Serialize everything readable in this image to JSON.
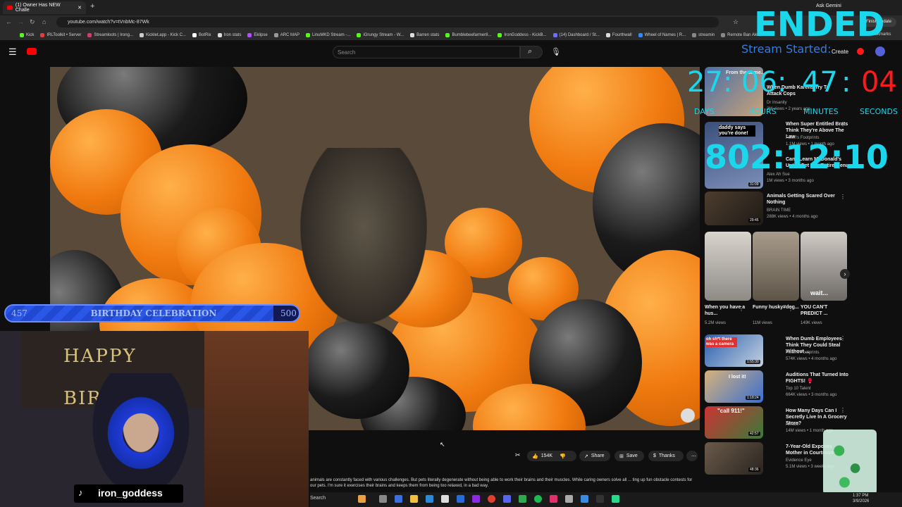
{
  "browser": {
    "tabs": [
      {
        "title": "(1) Owner Has NEW Challe"
      }
    ],
    "url": "youtube.com/watch?v=tVnbMc-87Wk",
    "ask_label": "Ask Gemini",
    "update_label": "Finish update",
    "all_bookmarks": "All Bookmarks",
    "bookmarks": [
      {
        "label": "Kick",
        "color": "#53fc18"
      },
      {
        "label": "IRLToolkit • Server",
        "color": "#e23c3c"
      },
      {
        "label": "Streamloots | Irong...",
        "color": "#d23b6f"
      },
      {
        "label": "Kicklet.app - Kick C...",
        "color": "#cccccc"
      },
      {
        "label": "BotRix",
        "color": "#ffffff"
      },
      {
        "label": "Iron stats",
        "color": "#dddddd"
      },
      {
        "label": "Eklipse",
        "color": "#b44dff"
      },
      {
        "label": "ARC MAP",
        "color": "#999999"
      },
      {
        "label": "LinuMKD Stream -...",
        "color": "#53fc18"
      },
      {
        "label": "iGrungy Stream - W...",
        "color": "#53fc18"
      },
      {
        "label": "Barren stats",
        "color": "#dddddd"
      },
      {
        "label": "Bumblebeefarmer8...",
        "color": "#53fc18"
      },
      {
        "label": "IronGoddess - KickB...",
        "color": "#53fc18"
      },
      {
        "label": "(14) Dashboard / St...",
        "color": "#6f6fff"
      },
      {
        "label": "Fourthwall",
        "color": "#dddddd"
      },
      {
        "label": "Wheel of Names | R...",
        "color": "#2d8cff"
      },
      {
        "label": "streamin",
        "color": "#888888"
      },
      {
        "label": "Remote Ban Alerts",
        "color": "#888888"
      }
    ]
  },
  "youtube": {
    "search_placeholder": "Search",
    "create_label": "Create",
    "description": "animals are constantly faced with various challenges. But pets literally degenerate without being able to work their brains and their muscles. While caring owners solve all ... ting up fun obstacle contests for our pets. I'm sure it exercises their brains and keeps them from being too relaxed, in a bad way.",
    "likes": "154K",
    "share_label": "Share",
    "save_label": "Save",
    "thanks_label": "Thanks"
  },
  "recommendations": [
    {
      "title": "From the same...",
      "channel": "",
      "meta": "",
      "duration": ""
    },
    {
      "title": "When Dumb Karens Try To Attack Cops",
      "channel": "Dr Insanity",
      "meta": "2M views • 2 years ago",
      "duration": ""
    },
    {
      "title": "When Super Entitled Brats Think They're Above The Law",
      "channel": "Felon's Footprints",
      "meta": "1.1M views • 1 month ago",
      "duration": ""
    },
    {
      "title": "Can I Learn McDonald's Until I Get The Entire Menu",
      "channel": "Alex Ah Sue",
      "meta": "1M views • 3 months ago",
      "duration": "31:09"
    },
    {
      "title": "Animals Getting Scared Over Nothing",
      "channel": "BRAIN TIME",
      "meta": "288K views • 4 months ago",
      "duration": "29:45"
    },
    {
      "title": "When Dumb Employees Think They Could Steal Without ...",
      "channel": "Felon's Footprints",
      "meta": "574K views • 4 months ago",
      "duration": "1:55:30"
    },
    {
      "title": "Auditions That Turned Into FIGHTS! 🥊",
      "channel": "Top 10 Talent",
      "meta": "664K views • 3 months ago",
      "duration": "1:18:24"
    },
    {
      "title": "How Many Days Can I Secretly Live In A Grocery Store?",
      "channel": "Airrack",
      "meta": "14M views • 1 month ago",
      "duration": "42:57"
    },
    {
      "title": "7-Year-Old Exposes Mother in Courtroom",
      "channel": "Evidence Eye",
      "meta": "5.1M views • 3 weeks ago",
      "duration": "48:36"
    }
  ],
  "shorts": [
    {
      "title": "When you have a hus...",
      "views": "5.2M views"
    },
    {
      "title": "Funny husky#dog...",
      "views": "11M views"
    },
    {
      "title": "YOU CAN'T PREDICT ...",
      "views": "149K views"
    }
  ],
  "thumb_texts": {
    "daddy": "daddy says you're done!",
    "ohsht": "oh sh*t there was a camera",
    "lost": "I lost it!",
    "call": "\"call 911!\"",
    "wait": "wait..."
  },
  "overlay": {
    "ended": "ENDED",
    "stream_started": "Stream Started:",
    "countdown": {
      "days": "27",
      "hours": "06",
      "minutes": "47",
      "seconds": "04",
      "sep": ":"
    },
    "countdown_labels": {
      "days": "DAYS",
      "hours": "HOURS",
      "minutes": "MINUTES",
      "seconds": "SECONDS"
    },
    "elapsed": "802:12:10",
    "goal": {
      "current": "457",
      "target": "500",
      "label": "BIRTHDAY CELEBRATION",
      "progress": 0.914
    },
    "banner": "HAPPY BIR",
    "streamer": "iron_goddess"
  },
  "taskbar": {
    "search": "Search",
    "time": "1:37 PM",
    "date": "3/9/2026"
  },
  "colors": {
    "accent_cyan": "#1ad7ec",
    "accent_red": "#ff1a1a",
    "goal_blue": "#2b57e8"
  }
}
